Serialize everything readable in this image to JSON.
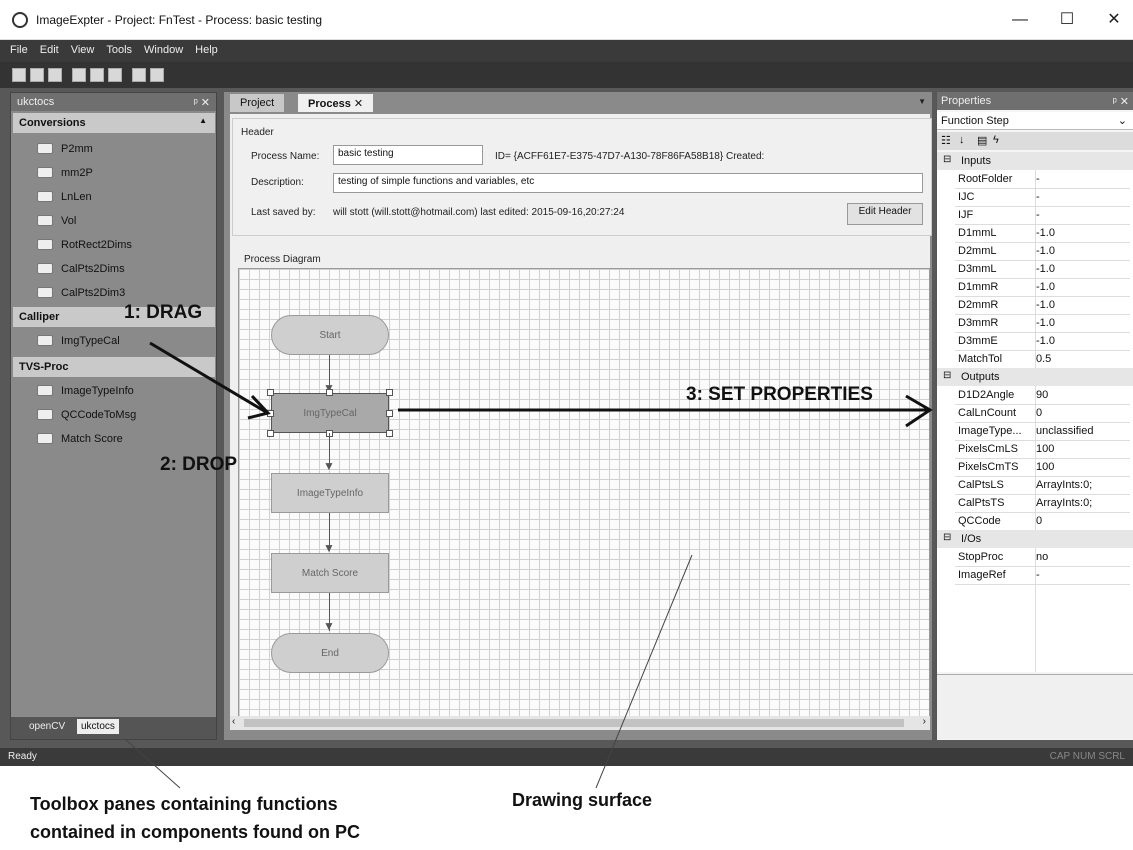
{
  "window": {
    "title": "ImageExpter - Project: FnTest - Process: basic testing",
    "minimize": "—",
    "maximize": "☐",
    "close": "✕"
  },
  "menu": [
    "File",
    "Edit",
    "View",
    "Tools",
    "Window",
    "Help"
  ],
  "toolbox": {
    "title": "ukctocs",
    "pin": "ᵖ ✕",
    "categories": [
      {
        "name": "Conversions",
        "items": [
          "P2mm",
          "mm2P",
          "LnLen",
          "Vol",
          "RotRect2Dims",
          "CalPts2Dims",
          "CalPts2Dim3"
        ]
      },
      {
        "name": "Calliper",
        "items": [
          "ImgTypeCal"
        ]
      },
      {
        "name": "TVS-Proc",
        "items": [
          "ImageTypeInfo",
          "QCCodeToMsg",
          "Match Score"
        ]
      }
    ],
    "tabs": [
      "openCV",
      "ukctocs"
    ]
  },
  "doc": {
    "tabs": [
      "Project",
      "Process"
    ],
    "close": "✕",
    "header_group": "Header",
    "process_name_label": "Process Name:",
    "process_name": "basic testing",
    "id_text": "ID= {ACFF61E7-E375-47D7-A130-78F86FA58B18}  Created:",
    "description_label": "Description:",
    "description": "testing of simple functions and variables, etc",
    "last_saved_label": "Last saved by:",
    "last_saved": "will stott (will.stott@hotmail.com) last edited: 2015-09-16,20:27:24",
    "edit_header": "Edit Header",
    "diagram_label": "Process Diagram"
  },
  "nodes": [
    "Start",
    "ImgTypeCal",
    "ImageTypeInfo",
    "Match Score",
    "End"
  ],
  "properties": {
    "title": "Properties",
    "object": "Function Step",
    "sections": [
      {
        "name": "Inputs",
        "rows": [
          [
            "RootFolder",
            "-"
          ],
          [
            "IJC",
            "-"
          ],
          [
            "IJF",
            "-"
          ],
          [
            "D1mmL",
            "-1.0"
          ],
          [
            "D2mmL",
            "-1.0"
          ],
          [
            "D3mmL",
            "-1.0"
          ],
          [
            "D1mmR",
            "-1.0"
          ],
          [
            "D2mmR",
            "-1.0"
          ],
          [
            "D3mmR",
            "-1.0"
          ],
          [
            "D3mmE",
            "-1.0"
          ],
          [
            "MatchTol",
            "0.5"
          ]
        ]
      },
      {
        "name": "Outputs",
        "rows": [
          [
            "D1D2Angle",
            "90"
          ],
          [
            "CalLnCount",
            "0"
          ],
          [
            "ImageType...",
            "unclassified"
          ],
          [
            "PixelsCmLS",
            "100"
          ],
          [
            "PixelsCmTS",
            "100"
          ],
          [
            "CalPtsLS",
            "ArrayInts:0;"
          ],
          [
            "CalPtsTS",
            "ArrayInts:0;"
          ],
          [
            "QCCode",
            "0"
          ]
        ]
      },
      {
        "name": "I/Os",
        "rows": [
          [
            "StopProc",
            "no"
          ],
          [
            "ImageRef",
            "-"
          ]
        ]
      }
    ]
  },
  "status": {
    "ready": "Ready",
    "indicators": "CAP NUM SCRL"
  },
  "annotations": {
    "drag": "1: DRAG",
    "drop": "2: DROP",
    "set": "3: SET PROPERTIES",
    "toolbox_caption_1": "Toolbox panes containing functions",
    "toolbox_caption_2": "contained in components found on PC",
    "drawing_caption": "Drawing surface"
  }
}
